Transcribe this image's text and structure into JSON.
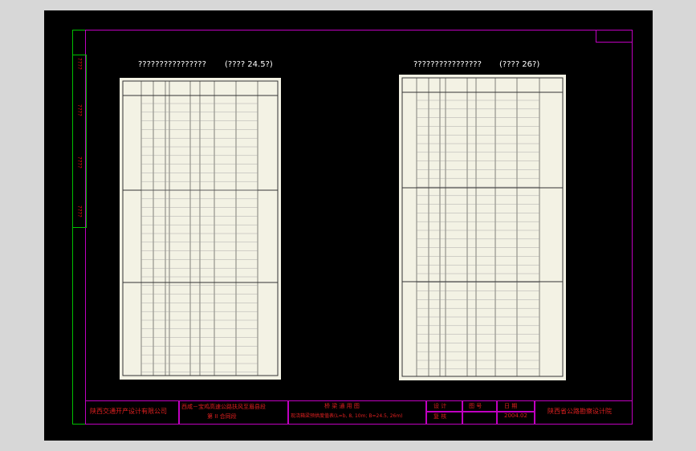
{
  "left_table": {
    "title": "????????????????",
    "note": "(???? 24.5?)"
  },
  "right_table": {
    "title": "????????????????",
    "note": "(???? 26?)"
  },
  "side_labels": [
    "????",
    "????",
    "????",
    "????"
  ],
  "title_block": {
    "company": "陕西交通开产设计有限公司",
    "project_line1": "西咸－宝鸡高速公路扶风至眉县段",
    "project_line2": "第 II 合同段",
    "drawing_line1": "桥 梁 通 用 图",
    "drawing_line2": "现浇箱梁预拱度值表(L=b, 8, 10m; B=24.5, 26m)",
    "design_label": "设 计",
    "drawing_no_label": "图 号",
    "date_label": "日 期",
    "date_value": "2004.02",
    "review_label": "复 核",
    "institute": "陕西省公路勘察设计院",
    "check_label": "审 核"
  },
  "colors": {
    "frame": "#c000c0",
    "border": "#00c000",
    "text_red": "#e02020",
    "sheet": "#f3f2e4"
  }
}
